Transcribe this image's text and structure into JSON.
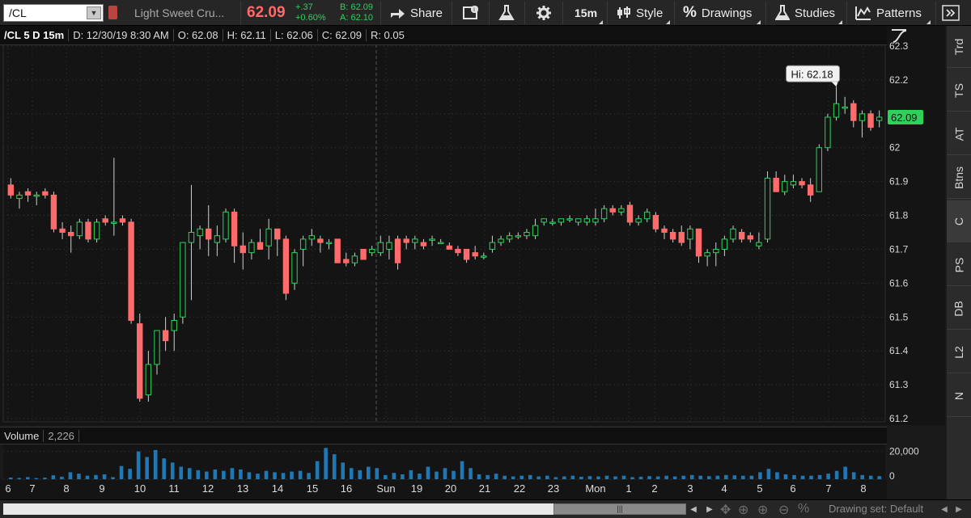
{
  "toolbar": {
    "symbol": "/CL",
    "description": "Light Sweet Cru...",
    "last": "62.09",
    "change": "+.37",
    "change_pct": "+0.60%",
    "bid": "B: 62.09",
    "ask": "A: 62.10",
    "share_label": "Share",
    "timeframe_label": "15m",
    "style_label": "Style",
    "drawings_label": "Drawings",
    "studies_label": "Studies",
    "patterns_label": "Patterns"
  },
  "info_bar": {
    "symbol_period": "/CL 5 D 15m",
    "datetime": "D: 12/30/19 8:30 AM",
    "open": "O: 62.08",
    "high": "H: 62.11",
    "low": "L: 62.06",
    "close": "C: 62.09",
    "range": "R: 0.05"
  },
  "volume_bar": {
    "label": "Volume",
    "value": "2,226"
  },
  "side_tabs": [
    "Trd",
    "TS",
    "AT",
    "Btns",
    "C",
    "PS",
    "DB",
    "L2",
    "N"
  ],
  "side_active": "C",
  "x_axis_labels": [
    "6",
    "7",
    "8",
    "9",
    "10",
    "11",
    "12",
    "13",
    "14",
    "15",
    "16",
    "Sun",
    "19",
    "20",
    "21",
    "22",
    "23",
    "Mon",
    "1",
    "2",
    "3",
    "4",
    "5",
    "6",
    "7",
    "8"
  ],
  "bottom": {
    "drawing_set": "Drawing set: Default"
  },
  "colors": {
    "up": "#2fd15a",
    "down": "#ff6b6b",
    "volume": "#1f77b4",
    "price_tag": "#2fd15a"
  },
  "chart_data": [
    {
      "type": "candlestick",
      "title": "/CL 5 D 15m",
      "ylim": [
        61.2,
        62.3
      ],
      "yticks": [
        62.3,
        62.2,
        62.1,
        62,
        61.9,
        61.8,
        61.7,
        61.6,
        61.5,
        61.4,
        61.3,
        61.2
      ],
      "ytick_labels": [
        "62.3",
        "62.2",
        "62.1",
        "62",
        "61.9",
        "61.8",
        "61.7",
        "61.6",
        "61.5",
        "61.4",
        "61.3",
        "61.2"
      ],
      "current_price": 62.09,
      "current_price_label": "62.09",
      "annotation": "Hi: 62.18",
      "annotation_price": 62.18,
      "candles": [
        [
          61.89,
          61.91,
          61.85,
          61.86
        ],
        [
          61.85,
          61.87,
          61.82,
          61.86
        ],
        [
          61.87,
          61.88,
          61.84,
          61.86
        ],
        [
          61.86,
          61.87,
          61.83,
          61.86
        ],
        [
          61.87,
          61.88,
          61.85,
          61.86
        ],
        [
          61.86,
          61.87,
          61.75,
          61.76
        ],
        [
          61.76,
          61.78,
          61.73,
          61.75
        ],
        [
          61.75,
          61.77,
          61.69,
          61.74
        ],
        [
          61.74,
          61.79,
          61.73,
          61.78
        ],
        [
          61.78,
          61.79,
          61.72,
          61.73
        ],
        [
          61.73,
          61.79,
          61.72,
          61.78
        ],
        [
          61.79,
          61.8,
          61.77,
          61.78
        ],
        [
          61.78,
          61.97,
          61.74,
          61.78
        ],
        [
          61.79,
          61.8,
          61.77,
          61.78
        ],
        [
          61.78,
          61.79,
          61.48,
          61.49
        ],
        [
          61.48,
          61.51,
          61.25,
          61.26
        ],
        [
          61.27,
          61.4,
          61.25,
          61.36
        ],
        [
          61.36,
          61.45,
          61.33,
          61.46
        ],
        [
          61.46,
          61.5,
          61.4,
          61.43
        ],
        [
          61.46,
          61.51,
          61.4,
          61.49
        ],
        [
          61.5,
          61.55,
          61.48,
          61.72
        ],
        [
          61.72,
          61.89,
          61.55,
          61.75
        ],
        [
          61.74,
          61.77,
          61.7,
          61.76
        ],
        [
          61.76,
          61.83,
          61.68,
          61.73
        ],
        [
          61.72,
          61.77,
          61.68,
          61.74
        ],
        [
          61.73,
          61.82,
          61.72,
          61.81
        ],
        [
          61.81,
          61.82,
          61.66,
          61.71
        ],
        [
          61.71,
          61.75,
          61.64,
          61.69
        ],
        [
          61.69,
          61.73,
          61.67,
          61.72
        ],
        [
          61.72,
          61.76,
          61.7,
          61.7
        ],
        [
          61.71,
          61.79,
          61.67,
          61.76
        ],
        [
          61.76,
          61.76,
          61.68,
          61.73
        ],
        [
          61.73,
          61.74,
          61.55,
          61.57
        ],
        [
          61.6,
          61.7,
          61.58,
          61.69
        ],
        [
          61.7,
          61.74,
          61.65,
          61.73
        ],
        [
          61.73,
          61.76,
          61.71,
          61.74
        ],
        [
          61.73,
          61.74,
          61.69,
          61.72
        ],
        [
          61.72,
          61.73,
          61.7,
          61.72
        ],
        [
          61.73,
          61.73,
          61.66,
          61.66
        ],
        [
          61.67,
          61.69,
          61.65,
          61.66
        ],
        [
          61.66,
          61.69,
          61.65,
          61.68
        ],
        [
          61.7,
          61.7,
          61.67,
          61.67
        ],
        [
          61.69,
          61.71,
          61.68,
          61.7
        ],
        [
          61.69,
          61.74,
          61.68,
          61.72
        ],
        [
          61.7,
          61.74,
          61.67,
          61.72
        ],
        [
          61.73,
          61.74,
          61.64,
          61.66
        ],
        [
          61.73,
          61.74,
          61.7,
          61.72
        ],
        [
          61.72,
          61.74,
          61.7,
          61.73
        ],
        [
          61.72,
          61.73,
          61.7,
          61.71
        ],
        [
          61.73,
          61.74,
          61.71,
          61.73
        ],
        [
          61.72,
          61.73,
          61.72,
          61.72
        ],
        [
          61.71,
          61.72,
          61.7,
          61.7
        ],
        [
          61.7,
          61.71,
          61.68,
          61.69
        ],
        [
          61.7,
          61.7,
          61.66,
          61.67
        ],
        [
          61.69,
          61.71,
          61.67,
          61.68
        ],
        [
          61.68,
          61.69,
          61.67,
          61.68
        ],
        [
          61.7,
          61.74,
          61.69,
          61.72
        ],
        [
          61.72,
          61.74,
          61.71,
          61.73
        ],
        [
          61.73,
          61.75,
          61.72,
          61.74
        ],
        [
          61.74,
          61.75,
          61.73,
          61.74
        ],
        [
          61.74,
          61.76,
          61.73,
          61.75
        ],
        [
          61.74,
          61.79,
          61.73,
          61.77
        ],
        [
          61.78,
          61.79,
          61.77,
          61.79
        ],
        [
          61.78,
          61.79,
          61.77,
          61.78
        ],
        [
          61.78,
          61.79,
          61.77,
          61.79
        ],
        [
          61.79,
          61.8,
          61.78,
          61.79
        ],
        [
          61.78,
          61.79,
          61.77,
          61.79
        ],
        [
          61.78,
          61.8,
          61.77,
          61.79
        ],
        [
          61.78,
          61.82,
          61.77,
          61.79
        ],
        [
          61.79,
          61.83,
          61.78,
          61.82
        ],
        [
          61.82,
          61.83,
          61.8,
          61.81
        ],
        [
          61.81,
          61.83,
          61.8,
          61.82
        ],
        [
          61.83,
          61.84,
          61.77,
          61.78
        ],
        [
          61.78,
          61.8,
          61.77,
          61.79
        ],
        [
          61.79,
          61.82,
          61.78,
          61.81
        ],
        [
          61.8,
          61.81,
          61.75,
          61.76
        ],
        [
          61.76,
          61.77,
          61.73,
          61.75
        ],
        [
          61.75,
          61.76,
          61.72,
          61.73
        ],
        [
          61.75,
          61.77,
          61.71,
          61.72
        ],
        [
          61.73,
          61.77,
          61.7,
          61.76
        ],
        [
          61.76,
          61.76,
          61.66,
          61.68
        ],
        [
          61.68,
          61.7,
          61.65,
          61.69
        ],
        [
          61.69,
          61.72,
          61.65,
          61.7
        ],
        [
          61.7,
          61.74,
          61.68,
          61.73
        ],
        [
          61.73,
          61.77,
          61.72,
          61.76
        ],
        [
          61.75,
          61.76,
          61.72,
          61.73
        ],
        [
          61.74,
          61.75,
          61.72,
          61.73
        ],
        [
          61.71,
          61.75,
          61.7,
          61.72
        ],
        [
          61.73,
          61.93,
          61.72,
          61.91
        ],
        [
          61.91,
          61.93,
          61.87,
          61.87
        ],
        [
          61.87,
          61.92,
          61.86,
          61.9
        ],
        [
          61.89,
          61.92,
          61.88,
          61.9
        ],
        [
          61.9,
          61.91,
          61.88,
          61.89
        ],
        [
          61.89,
          61.91,
          61.84,
          61.86
        ],
        [
          61.87,
          62.01,
          61.87,
          62.0
        ],
        [
          62.0,
          62.1,
          61.99,
          62.09
        ],
        [
          62.09,
          62.18,
          62.08,
          62.13
        ],
        [
          62.12,
          62.15,
          62.1,
          62.12
        ],
        [
          62.13,
          62.14,
          62.06,
          62.08
        ],
        [
          62.08,
          62.11,
          62.03,
          62.1
        ],
        [
          62.1,
          62.11,
          62.05,
          62.06
        ],
        [
          62.08,
          62.11,
          62.06,
          62.09
        ]
      ]
    },
    {
      "type": "bar",
      "title": "Volume",
      "ylim": [
        0,
        25000
      ],
      "yticks": [
        20000,
        0
      ],
      "ytick_labels": [
        "20,000",
        "0"
      ],
      "values": [
        1200,
        900,
        1500,
        800,
        1100,
        2800,
        1800,
        5000,
        4000,
        2500,
        3000,
        3500,
        1500,
        9500,
        7500,
        20000,
        16000,
        21000,
        15000,
        12000,
        9000,
        8000,
        6500,
        5500,
        7000,
        6000,
        8000,
        7000,
        5000,
        4000,
        6000,
        5000,
        4500,
        5500,
        6000,
        4500,
        13000,
        22500,
        18000,
        12000,
        8000,
        6500,
        9000,
        8000,
        3000,
        4500,
        3500,
        6500,
        4000,
        9000,
        5500,
        8000,
        6000,
        13000,
        8000,
        3500,
        3000,
        4000,
        2500,
        2000,
        2500,
        3000,
        2000,
        2500,
        1500,
        2000,
        2500,
        1800,
        2200,
        2000,
        2500,
        2000,
        2500,
        1500,
        1800,
        2200,
        2000,
        2500,
        2000,
        2500,
        3000,
        2500,
        2200,
        2500,
        3000,
        2800,
        2500,
        2500,
        5000,
        7500,
        5000,
        3500,
        3000,
        2500,
        2500,
        3000,
        4000,
        6000,
        9000,
        5000,
        3000,
        2500,
        2226
      ],
      "xtick_labels": [
        "6",
        "7",
        "8",
        "9",
        "10",
        "11",
        "12",
        "13",
        "14",
        "15",
        "16",
        "Sun",
        "19",
        "20",
        "21",
        "22",
        "23",
        "Mon",
        "1",
        "2",
        "3",
        "4",
        "5",
        "6",
        "7",
        "8"
      ]
    }
  ]
}
